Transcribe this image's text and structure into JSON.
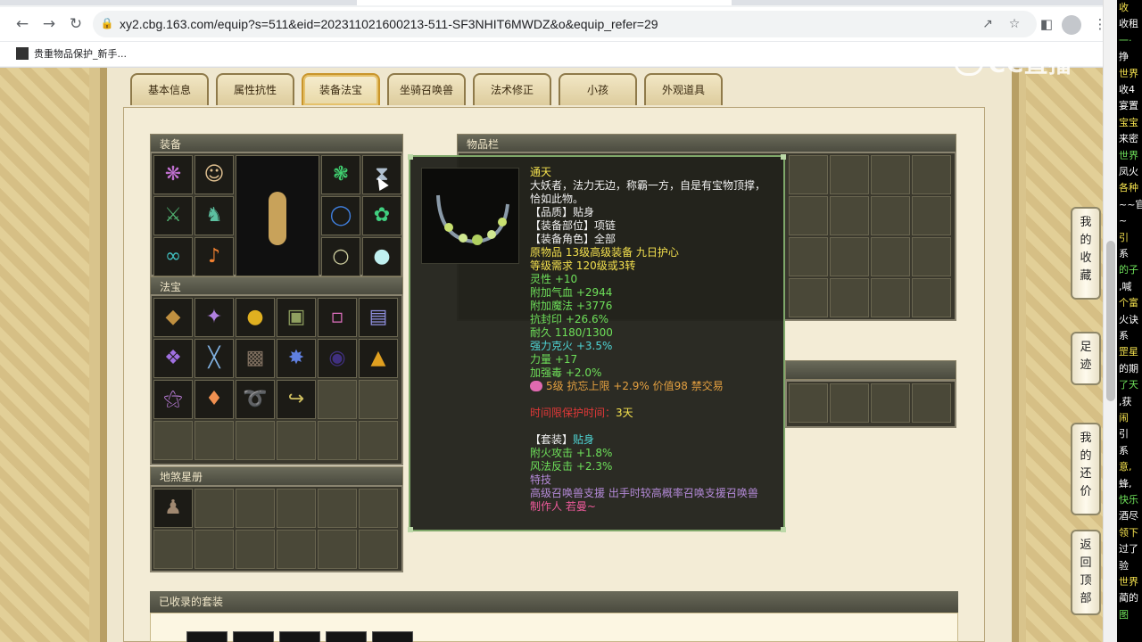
{
  "browser": {
    "url": "xy2.cbg.163.com/equip?s=511&eid=202311021600213-511-SF3NHIT6MWDZ&o&equip_refer=29",
    "bookmark": "贵重物品保护_新手..."
  },
  "tabs": [
    "基本信息",
    "属性抗性",
    "装备法宝",
    "坐骑召唤兽",
    "法术修正",
    "小孩",
    "外观道具"
  ],
  "active_tab": "装备法宝",
  "panels": {
    "equip": "装备",
    "fabao": "法宝",
    "dishaxingce": "地煞星册",
    "inventory": "物品栏",
    "suits": "已收录的套装"
  },
  "tooltip": {
    "name": "通天",
    "desc1": "大妖者，法力无边，称霸一方，自是有宝物顶撑，",
    "desc2": "恰如此物。",
    "quality": "【品质】贴身",
    "slot": "【装备部位】项链",
    "role": "【装备角色】全部",
    "origin": "原物品 13级高级装备 九日护心",
    "level": "等级需求 120级或3转",
    "lingxing": "灵性 +10",
    "hp": "附加气血 +2944",
    "mp": "附加魔法 +3776",
    "kangfengyin": "抗封印 +26.6%",
    "durability": "耐久 1180/1300",
    "kehuo": "强力克火 +3.5%",
    "strength": "力量 +17",
    "jiaqiangdu": "加强毒 +2.0%",
    "gem": "5级 抗忘上限 +2.9% 价值98 禁交易",
    "protect_label": "时间限保护时间：",
    "protect_value": "3天",
    "suit_label": "【套装】",
    "suit_name": "贴身",
    "suit1": "附火攻击 +1.8%",
    "suit2": "风法反击 +2.3%",
    "skill_title": "特技",
    "skill": "高级召唤兽支援 出手时较高概率召唤支援召唤兽",
    "maker": "制作人 若曼~"
  },
  "side_menu": [
    [
      "我",
      "的",
      "收",
      "藏"
    ],
    [
      "足",
      "迹"
    ],
    [
      "我",
      "的",
      "还",
      "价"
    ],
    [
      "返",
      "回",
      "顶",
      "部"
    ]
  ],
  "watermark": "CC直播",
  "chat": [
    "收",
    "收租",
    "一·",
    "挣",
    "世界",
    "收4",
    "宴置",
    "宝宝",
    "来密",
    "世界",
    "凤火",
    "各种",
    "~~官",
    "~",
    "引",
    "系",
    "的子",
    ",喊",
    "个富",
    "火诀",
    "系",
    "罡星",
    "的期",
    "了天",
    ",获",
    "闹",
    "引",
    "系",
    "意,",
    "蜂,",
    "快乐",
    "酒尽",
    "领下",
    "过了",
    "验",
    "世界",
    "蔺的",
    "图"
  ]
}
